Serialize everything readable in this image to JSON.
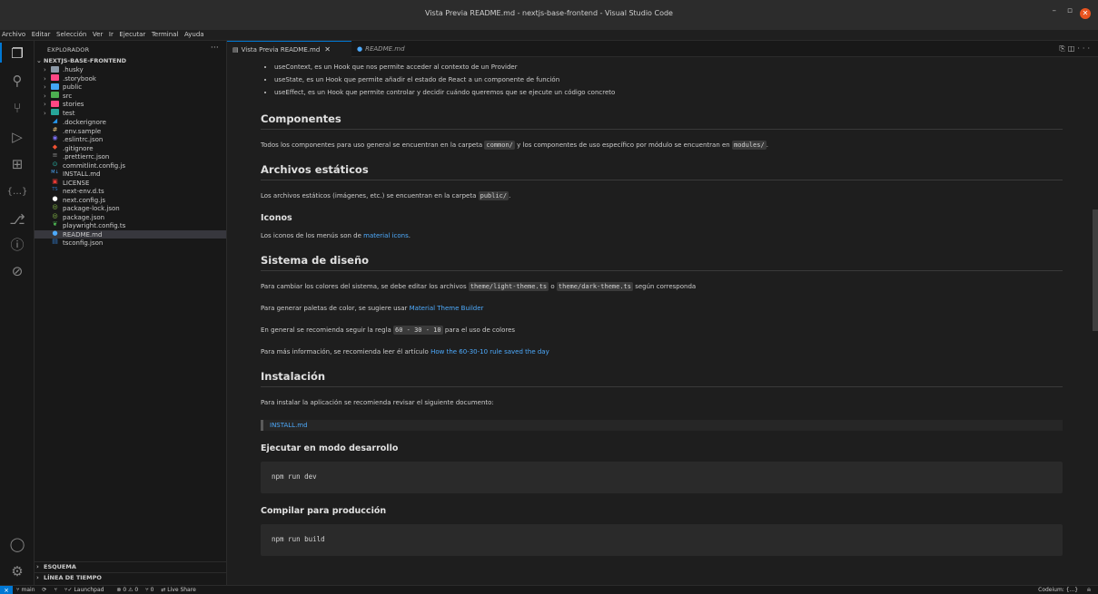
{
  "window": {
    "title": "Vista Previa README.md - nextjs-base-frontend - Visual Studio Code"
  },
  "menu": [
    "Archivo",
    "Editar",
    "Selección",
    "Ver",
    "Ir",
    "Ejecutar",
    "Terminal",
    "Ayuda"
  ],
  "explorer": {
    "title": "EXPLORADOR",
    "project": "NEXTJS-BASE-FRONTEND",
    "items": [
      {
        "label": ".husky",
        "folder": true
      },
      {
        "label": ".storybook",
        "folder": true
      },
      {
        "label": "public",
        "folder": true
      },
      {
        "label": "src",
        "folder": true
      },
      {
        "label": "stories",
        "folder": true
      },
      {
        "label": "test",
        "folder": true
      },
      {
        "label": ".dockerignore"
      },
      {
        "label": ".env.sample"
      },
      {
        "label": ".eslintrc.json"
      },
      {
        "label": ".gitignore"
      },
      {
        "label": ".prettierrc.json"
      },
      {
        "label": "commitlint.config.js"
      },
      {
        "label": "INSTALL.md"
      },
      {
        "label": "LICENSE"
      },
      {
        "label": "next-env.d.ts"
      },
      {
        "label": "next.config.js"
      },
      {
        "label": "package-lock.json"
      },
      {
        "label": "package.json"
      },
      {
        "label": "playwright.config.ts"
      },
      {
        "label": "README.md",
        "selected": true
      },
      {
        "label": "tsconfig.json"
      }
    ],
    "outline": "ESQUEMA",
    "timeline": "LÍNEA DE TIEMPO"
  },
  "tabs": [
    {
      "label": "Vista Previa README.md",
      "active": true
    },
    {
      "label": "README.md",
      "active": false
    }
  ],
  "doc": {
    "bullets": [
      "useContext, es un Hook que nos permite acceder al contexto de un Provider",
      "useState, es un Hook que permite añadir el estado de React a un componente de función",
      "useEffect, es un Hook que permite controlar y decidir cuándo queremos que se ejecute un código concreto"
    ],
    "componentes": {
      "heading": "Componentes",
      "t1": "Todos los componentes para uso general se encuentran en la carpeta",
      "c1": "common/",
      "t2": "y los componentes de uso específico por módulo se encuentran en",
      "c2": "modules/",
      "t3": "."
    },
    "estaticos": {
      "heading": "Archivos estáticos",
      "t1": "Los archivos estáticos (imágenes, etc.) se encuentran en la carpeta",
      "c1": "public/",
      "t2": "."
    },
    "iconos": {
      "heading": "Iconos",
      "t1": "Los iconos de los menús son de",
      "link": "material icons",
      "t2": "."
    },
    "diseno": {
      "heading": "Sistema de diseño",
      "p1a": "Para cambiar los colores del sistema, se debe editar los archivos",
      "p1c1": "theme/light-theme.ts",
      "p1b": "o",
      "p1c2": "theme/dark-theme.ts",
      "p1d": "según corresponda",
      "p2a": "Para generar paletas de color, se sugiere usar",
      "p2link": "Material Theme Builder",
      "p3a": "En general se recomienda seguir la regla",
      "p3code": "60 - 30 - 10",
      "p3b": "para el uso de colores",
      "p4a": "Para más información, se recomienda leer él artículo",
      "p4link": "How the 60-30-10 rule saved the day"
    },
    "instalacion": {
      "heading": "Instalación",
      "p1": "Para instalar la aplicación se recomienda revisar el siguiente documento:",
      "quote": "INSTALL.md"
    },
    "dev": {
      "heading": "Ejecutar en modo desarrollo",
      "code": "npm run dev"
    },
    "prod": {
      "heading": "Compilar para producción",
      "code": "npm run build"
    }
  },
  "status": {
    "branch": "main",
    "launchpad": "Launchpad",
    "problems": "⊗ 0 ⚠ 0",
    "ports": "⑂ 0",
    "liveshare": "Live Share",
    "codeium": "Codeium: {...}"
  },
  "colors": {
    "accent": "#0078d4",
    "link": "#4daafc",
    "editor_bg": "#1e1e1e"
  }
}
